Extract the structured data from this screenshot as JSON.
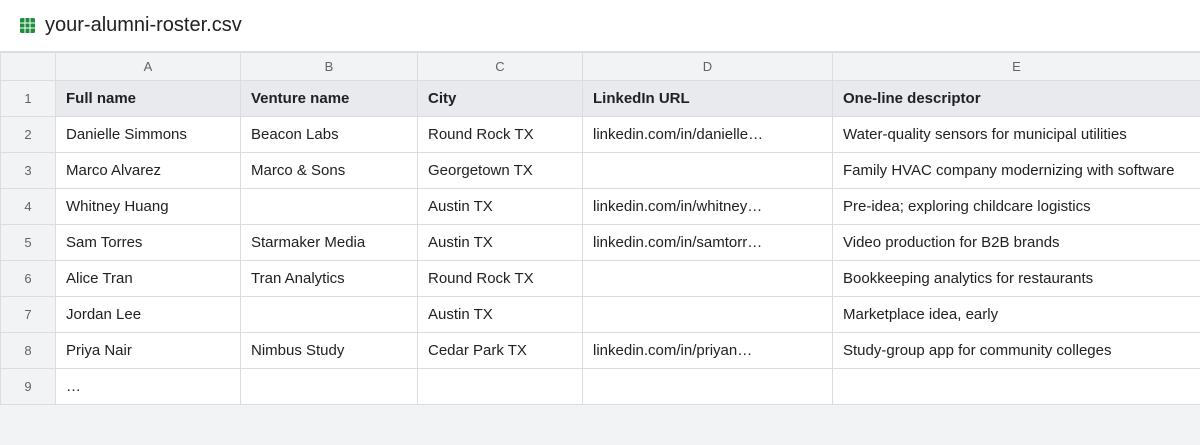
{
  "file": {
    "name": "your-alumni-roster.csv",
    "icon": "spreadsheet-icon",
    "icon_color": "#1e8e3e"
  },
  "columns": [
    "A",
    "B",
    "C",
    "D",
    "E"
  ],
  "rows": [
    {
      "num": "1",
      "cells": [
        "Full name",
        "Venture name",
        "City",
        "LinkedIn URL",
        "One-line descriptor"
      ]
    },
    {
      "num": "2",
      "cells": [
        "Danielle Simmons",
        "Beacon Labs",
        "Round Rock TX",
        "linkedin.com/in/danielle…",
        "Water-quality sensors for municipal utilities"
      ]
    },
    {
      "num": "3",
      "cells": [
        "Marco Alvarez",
        "Marco & Sons",
        "Georgetown TX",
        "",
        "Family HVAC company modernizing with software"
      ]
    },
    {
      "num": "4",
      "cells": [
        "Whitney Huang",
        "",
        "Austin TX",
        "linkedin.com/in/whitney…",
        "Pre-idea; exploring childcare logistics"
      ]
    },
    {
      "num": "5",
      "cells": [
        "Sam Torres",
        "Starmaker Media",
        "Austin TX",
        "linkedin.com/in/samtorr…",
        "Video production for B2B brands"
      ]
    },
    {
      "num": "6",
      "cells": [
        "Alice Tran",
        "Tran Analytics",
        "Round Rock TX",
        "",
        "Bookkeeping analytics for restaurants"
      ]
    },
    {
      "num": "7",
      "cells": [
        "Jordan Lee",
        "",
        "Austin TX",
        "",
        "Marketplace idea, early"
      ]
    },
    {
      "num": "8",
      "cells": [
        "Priya Nair",
        "Nimbus Study",
        "Cedar Park TX",
        "linkedin.com/in/priyan…",
        "Study-group app for community colleges"
      ]
    },
    {
      "num": "9",
      "cells": [
        "…",
        "",
        "",
        "",
        ""
      ]
    }
  ]
}
